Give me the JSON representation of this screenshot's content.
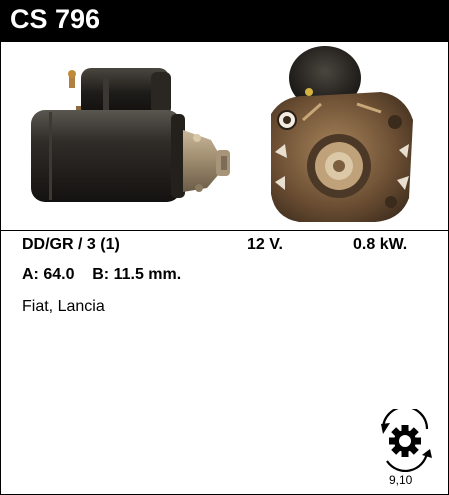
{
  "header": {
    "title": "CS 796"
  },
  "images": {
    "side_view": "starter-motor-side-view",
    "front_view": "starter-motor-front-view"
  },
  "specs": {
    "type": "DD/GR / 3 (1)",
    "voltage": "12 V.",
    "power": "0.8 kW.",
    "dims": "A: 64.0    B: 11.5 mm."
  },
  "applications": "Fiat, Lancia",
  "rotation": {
    "icon": "clockwise-rotation-gear-icon",
    "label": "9,10"
  },
  "colors": {
    "header_bg": "#000000",
    "header_text": "#ffffff",
    "motor_body": "#3a3732",
    "motor_front": "#7a5e3e"
  }
}
